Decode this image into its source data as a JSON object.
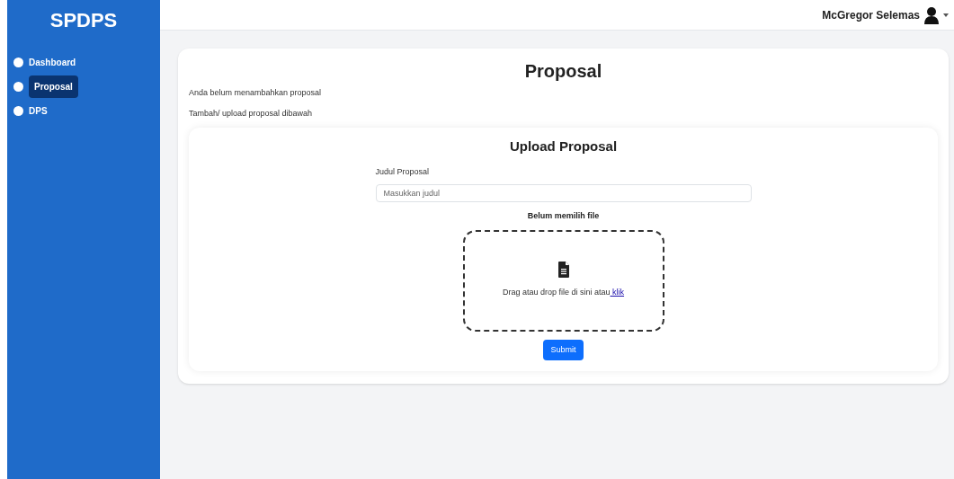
{
  "sidebar": {
    "brand": "SPDPS",
    "items": [
      {
        "label": "Dashboard",
        "selected": false
      },
      {
        "label": "Proposal",
        "selected": true
      },
      {
        "label": "DPS",
        "selected": false
      }
    ]
  },
  "topbar": {
    "user": "McGregor Selemas"
  },
  "page": {
    "title": "Proposal",
    "messages": [
      "Anda belum menambahkan proposal",
      "Tambah/ upload proposal dibawah"
    ],
    "upload": {
      "title": "Upload Proposal",
      "field_label": "Judul Proposal",
      "placeholder": "Masukkan judul",
      "file_status": "Belum memilih file",
      "drop_text": "Drag atau drop file di sini atau",
      "drop_link": "klik",
      "submit": "Submit"
    }
  }
}
